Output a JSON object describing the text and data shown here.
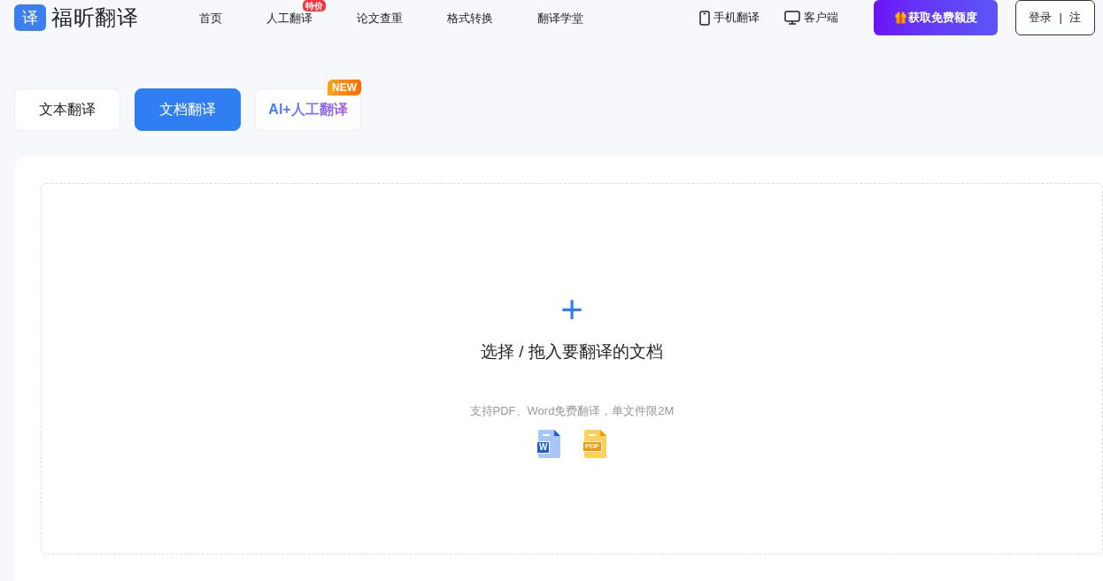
{
  "logo": {
    "mark": "译",
    "name": "福昕翻译"
  },
  "nav": [
    {
      "label": "首页"
    },
    {
      "label": "人工翻译",
      "badge": "特价"
    },
    {
      "label": "论文查重"
    },
    {
      "label": "格式转换"
    },
    {
      "label": "翻译学堂"
    }
  ],
  "header_links": [
    {
      "kind": "phone",
      "label": "手机翻译"
    },
    {
      "kind": "desktop",
      "label": "客户端"
    }
  ],
  "promo_button": "获取免费额度",
  "auth": {
    "login": "登录",
    "separator": "|",
    "register": "注"
  },
  "tabs": [
    {
      "label": "文本翻译",
      "selected": false
    },
    {
      "label": "文档翻译",
      "selected": true
    },
    {
      "label": "AI+人工翻译",
      "selected": false,
      "badge": "NEW"
    }
  ],
  "upload": {
    "plus": "+",
    "title": "选择 / 拖入要翻译的文档",
    "hint": "支持PDF、Word免费翻译，单文件限2M",
    "file_icons": [
      {
        "kind": "word",
        "label": "W"
      },
      {
        "kind": "pdf",
        "label": "PDF"
      }
    ]
  }
}
